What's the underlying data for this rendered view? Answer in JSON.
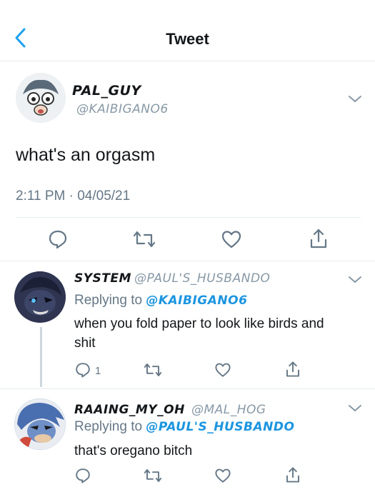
{
  "header": {
    "title": "Tweet"
  },
  "main_tweet": {
    "display_name": "PAL_GUY",
    "handle": "@KAIBIGANO6",
    "text": "what's an orgasm",
    "timestamp": "2:11 PM · 04/05/21"
  },
  "replies": [
    {
      "display_name": "SYSTEM",
      "handle": "@PAUL'S_HUSBANDO",
      "replying_prefix": "Replying to",
      "replying_to": "@KAIBIGANO6",
      "text_line1": "when you fold paper to look like birds and",
      "text_line2": "shit",
      "reply_count": "1"
    },
    {
      "display_name": "RAAING_MY_OH",
      "handle": "@MAL_HOG",
      "replying_prefix": "Replying to",
      "replying_to": "@PAUL'S_HUSBANDO",
      "text_line1": "that's oregano bitch"
    }
  ],
  "colors": {
    "accent": "#1b95e0",
    "muted": "#657786",
    "icon": "#657786",
    "border": "#e6ecf0"
  }
}
